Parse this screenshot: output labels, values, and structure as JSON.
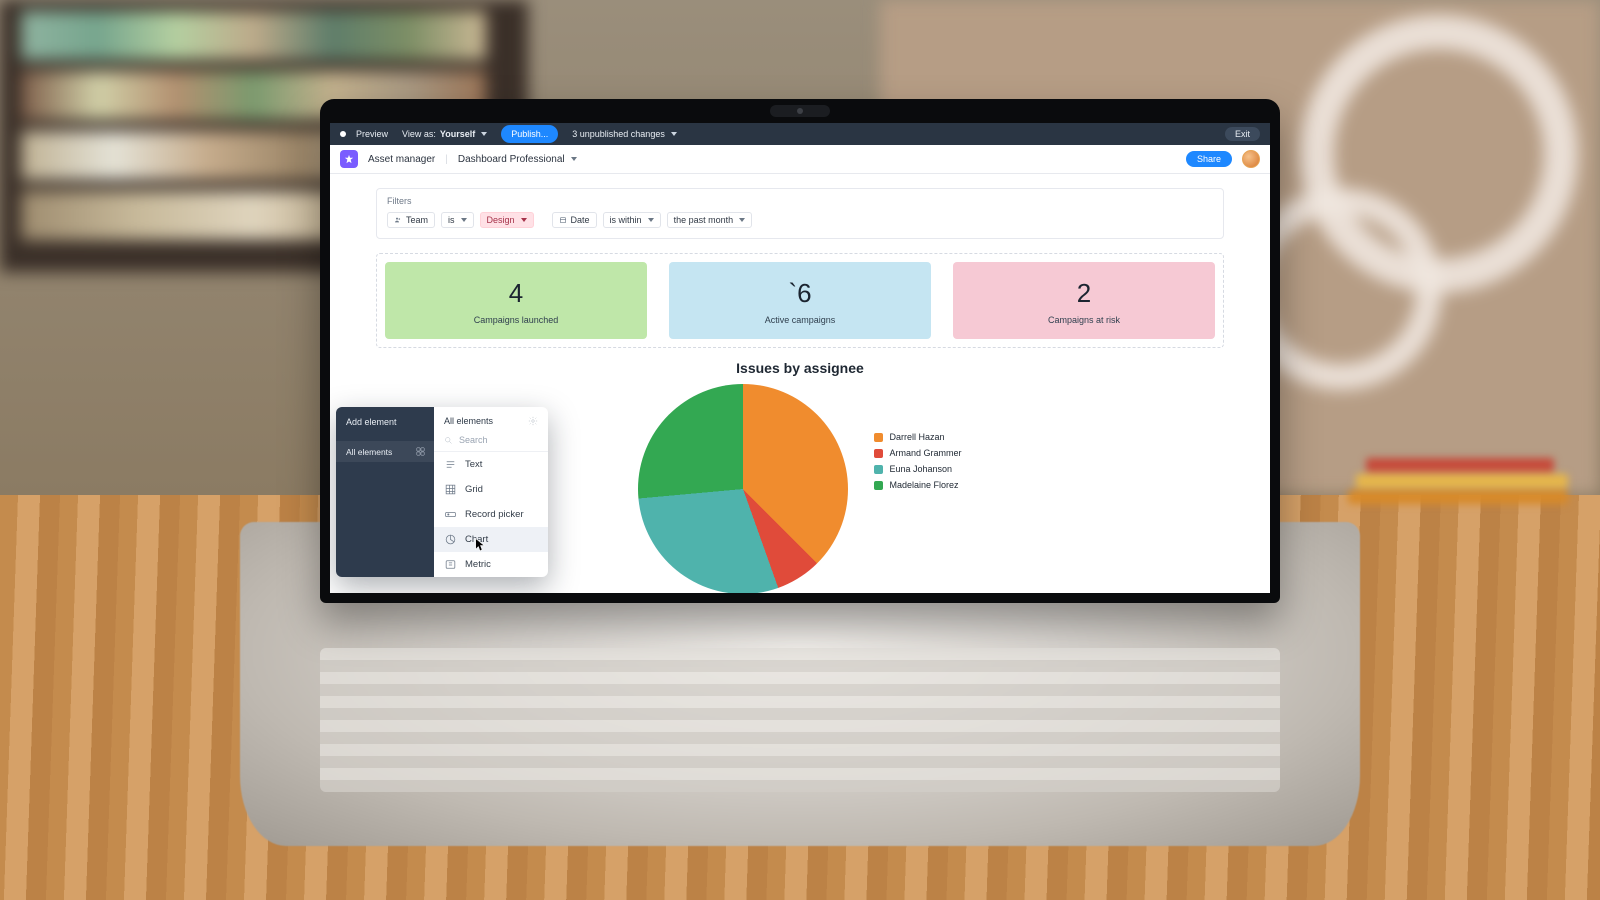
{
  "topbar": {
    "preview_label": "Preview",
    "view_as_prefix": "View as:",
    "view_as_value": "Yourself",
    "publish_label": "Publish...",
    "changes_label": "3 unpublished changes",
    "exit_label": "Exit"
  },
  "subbar": {
    "app_name": "Asset manager",
    "page_name": "Dashboard Professional",
    "share_label": "Share"
  },
  "filters": {
    "title": "Filters",
    "team_chip": "Team",
    "op_is": "is",
    "team_value": "Design",
    "date_chip": "Date",
    "op_within": "is within",
    "date_value": "the past month"
  },
  "metrics": [
    {
      "value": "4",
      "label": "Campaigns launched"
    },
    {
      "value": "`6",
      "label": "Active campaigns"
    },
    {
      "value": "2",
      "label": "Campaigns at risk"
    }
  ],
  "chart_title": "Issues by assignee",
  "legend": {
    "a": "Darrell Hazan",
    "b": "Armand Grammer",
    "c": "Euna Johanson",
    "d": "Madelaine Florez"
  },
  "popover": {
    "left_title": "Add element",
    "left_item": "All elements",
    "right_title": "All elements",
    "search_placeholder": "Search",
    "opts": {
      "text": "Text",
      "grid": "Grid",
      "record": "Record picker",
      "chart": "Chart",
      "metric": "Metric"
    }
  },
  "colors": {
    "orange": "#f08c2e",
    "red": "#e04b3a",
    "teal": "#4fb3ac",
    "green": "#33a852"
  },
  "chart_data": {
    "type": "pie",
    "title": "Issues by assignee",
    "series": [
      {
        "name": "Darrell Hazan",
        "value": 32,
        "color": "#f08c2e"
      },
      {
        "name": "Armand Grammer",
        "value": 7,
        "color": "#e04b3a"
      },
      {
        "name": "Euna Johanson",
        "value": 29,
        "color": "#4fb3ac"
      },
      {
        "name": "Madelaine Florez",
        "value": 32,
        "color": "#33a852"
      }
    ]
  }
}
